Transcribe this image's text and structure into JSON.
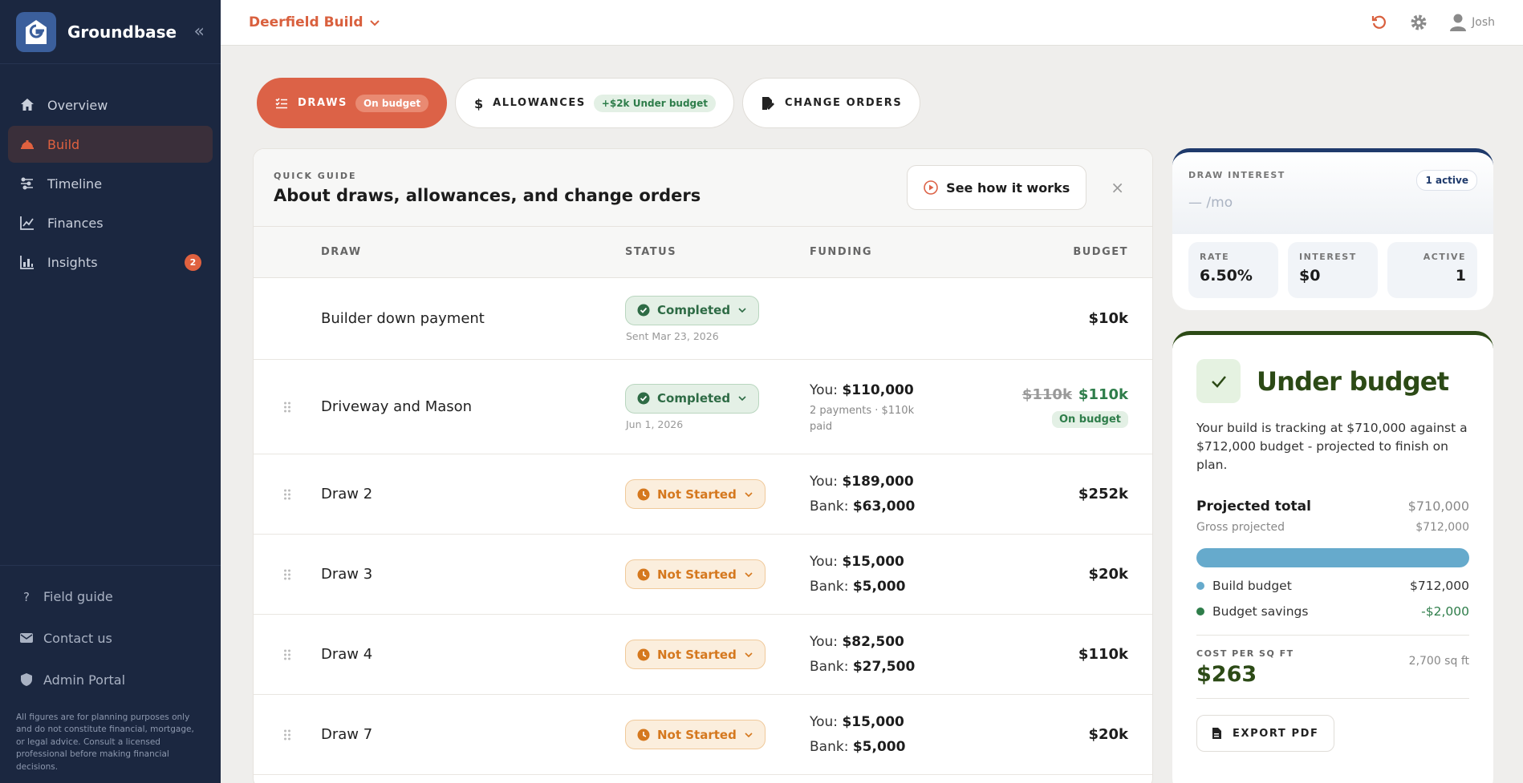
{
  "app": {
    "name": "Groundbase"
  },
  "project": {
    "name": "Deerfield Build"
  },
  "user": {
    "name": "Josh"
  },
  "sidebar": {
    "items": [
      {
        "label": "Overview",
        "icon": "home-icon"
      },
      {
        "label": "Build",
        "icon": "hardhat-icon",
        "active": true
      },
      {
        "label": "Timeline",
        "icon": "timeline-icon"
      },
      {
        "label": "Finances",
        "icon": "chart-line-icon"
      },
      {
        "label": "Insights",
        "icon": "bar-chart-icon",
        "badge": "2"
      }
    ],
    "bottom": [
      {
        "label": "Field guide",
        "icon": "question-icon"
      },
      {
        "label": "Contact us",
        "icon": "mail-icon"
      },
      {
        "label": "Admin Portal",
        "icon": "shield-icon"
      }
    ],
    "disclaimer": "All figures are for planning purposes only and do not constitute financial, mortgage, or legal advice. Consult a licensed professional before making financial decisions."
  },
  "tabs": [
    {
      "label": "DRAWS",
      "pill": "On budget",
      "icon": "checklist-icon"
    },
    {
      "label": "ALLOWANCES",
      "pill": "+$2k Under budget",
      "icon": "dollar-icon"
    },
    {
      "label": "CHANGE ORDERS",
      "icon": "document-edit-icon"
    }
  ],
  "guide": {
    "kicker": "QUICK GUIDE",
    "title": "About draws, allowances, and change orders",
    "button": "See how it works"
  },
  "table": {
    "headers": {
      "draw": "DRAW",
      "status": "STATUS",
      "funding": "FUNDING",
      "budget": "BUDGET"
    },
    "rows": [
      {
        "name": "Builder down payment",
        "status": "Completed",
        "date": "Sent Mar 23, 2026",
        "budget": "$10k",
        "grip": false
      },
      {
        "name": "Driveway and Mason",
        "status": "Completed",
        "date": "Jun 1, 2026",
        "you_label": "You:",
        "you": "$110,000",
        "sub": "2 payments · $110k paid",
        "budget_old": "$110k",
        "budget": "$110k",
        "budget_badge": "On budget",
        "grip": true
      },
      {
        "name": "Draw 2",
        "status": "Not Started",
        "you_label": "You:",
        "you": "$189,000",
        "bank_label": "Bank:",
        "bank": "$63,000",
        "budget": "$252k",
        "grip": true
      },
      {
        "name": "Draw 3",
        "status": "Not Started",
        "you_label": "You:",
        "you": "$15,000",
        "bank_label": "Bank:",
        "bank": "$5,000",
        "budget": "$20k",
        "grip": true
      },
      {
        "name": "Draw 4",
        "status": "Not Started",
        "you_label": "You:",
        "you": "$82,500",
        "bank_label": "Bank:",
        "bank": "$27,500",
        "budget": "$110k",
        "grip": true
      },
      {
        "name": "Draw 7",
        "status": "Not Started",
        "you_label": "You:",
        "you": "$15,000",
        "bank_label": "Bank:",
        "bank": "$5,000",
        "budget": "$20k",
        "grip": true
      }
    ]
  },
  "interest": {
    "kicker": "DRAW INTEREST",
    "active_badge": "1 active",
    "amount_placeholder": "—",
    "amount_suffix": "/mo",
    "stats": [
      {
        "label": "RATE",
        "value": "6.50%"
      },
      {
        "label": "INTEREST",
        "value": "$0"
      },
      {
        "label": "ACTIVE",
        "value": "1"
      }
    ]
  },
  "budget_card": {
    "title": "Under budget",
    "description": "Your build is tracking at $710,000 against a $712,000 budget - projected to finish on plan.",
    "projected_label": "Projected total",
    "projected_value": "$710,000",
    "gross_label": "Gross projected",
    "gross_value": "$712,000",
    "legend": [
      {
        "label": "Build budget",
        "value": "$712,000",
        "color": "#66aacc"
      },
      {
        "label": "Budget savings",
        "value": "-$2,000",
        "color": "#2e7d4a"
      }
    ],
    "cpsf_label": "COST PER SQ FT",
    "cpsf_value": "$263",
    "sqft": "2,700 sq ft",
    "export_label": "EXPORT PDF"
  },
  "colors": {
    "accent": "#dc6247",
    "sidebar": "#1b2740",
    "success": "#2c4a16",
    "info": "#1f3a6b"
  }
}
